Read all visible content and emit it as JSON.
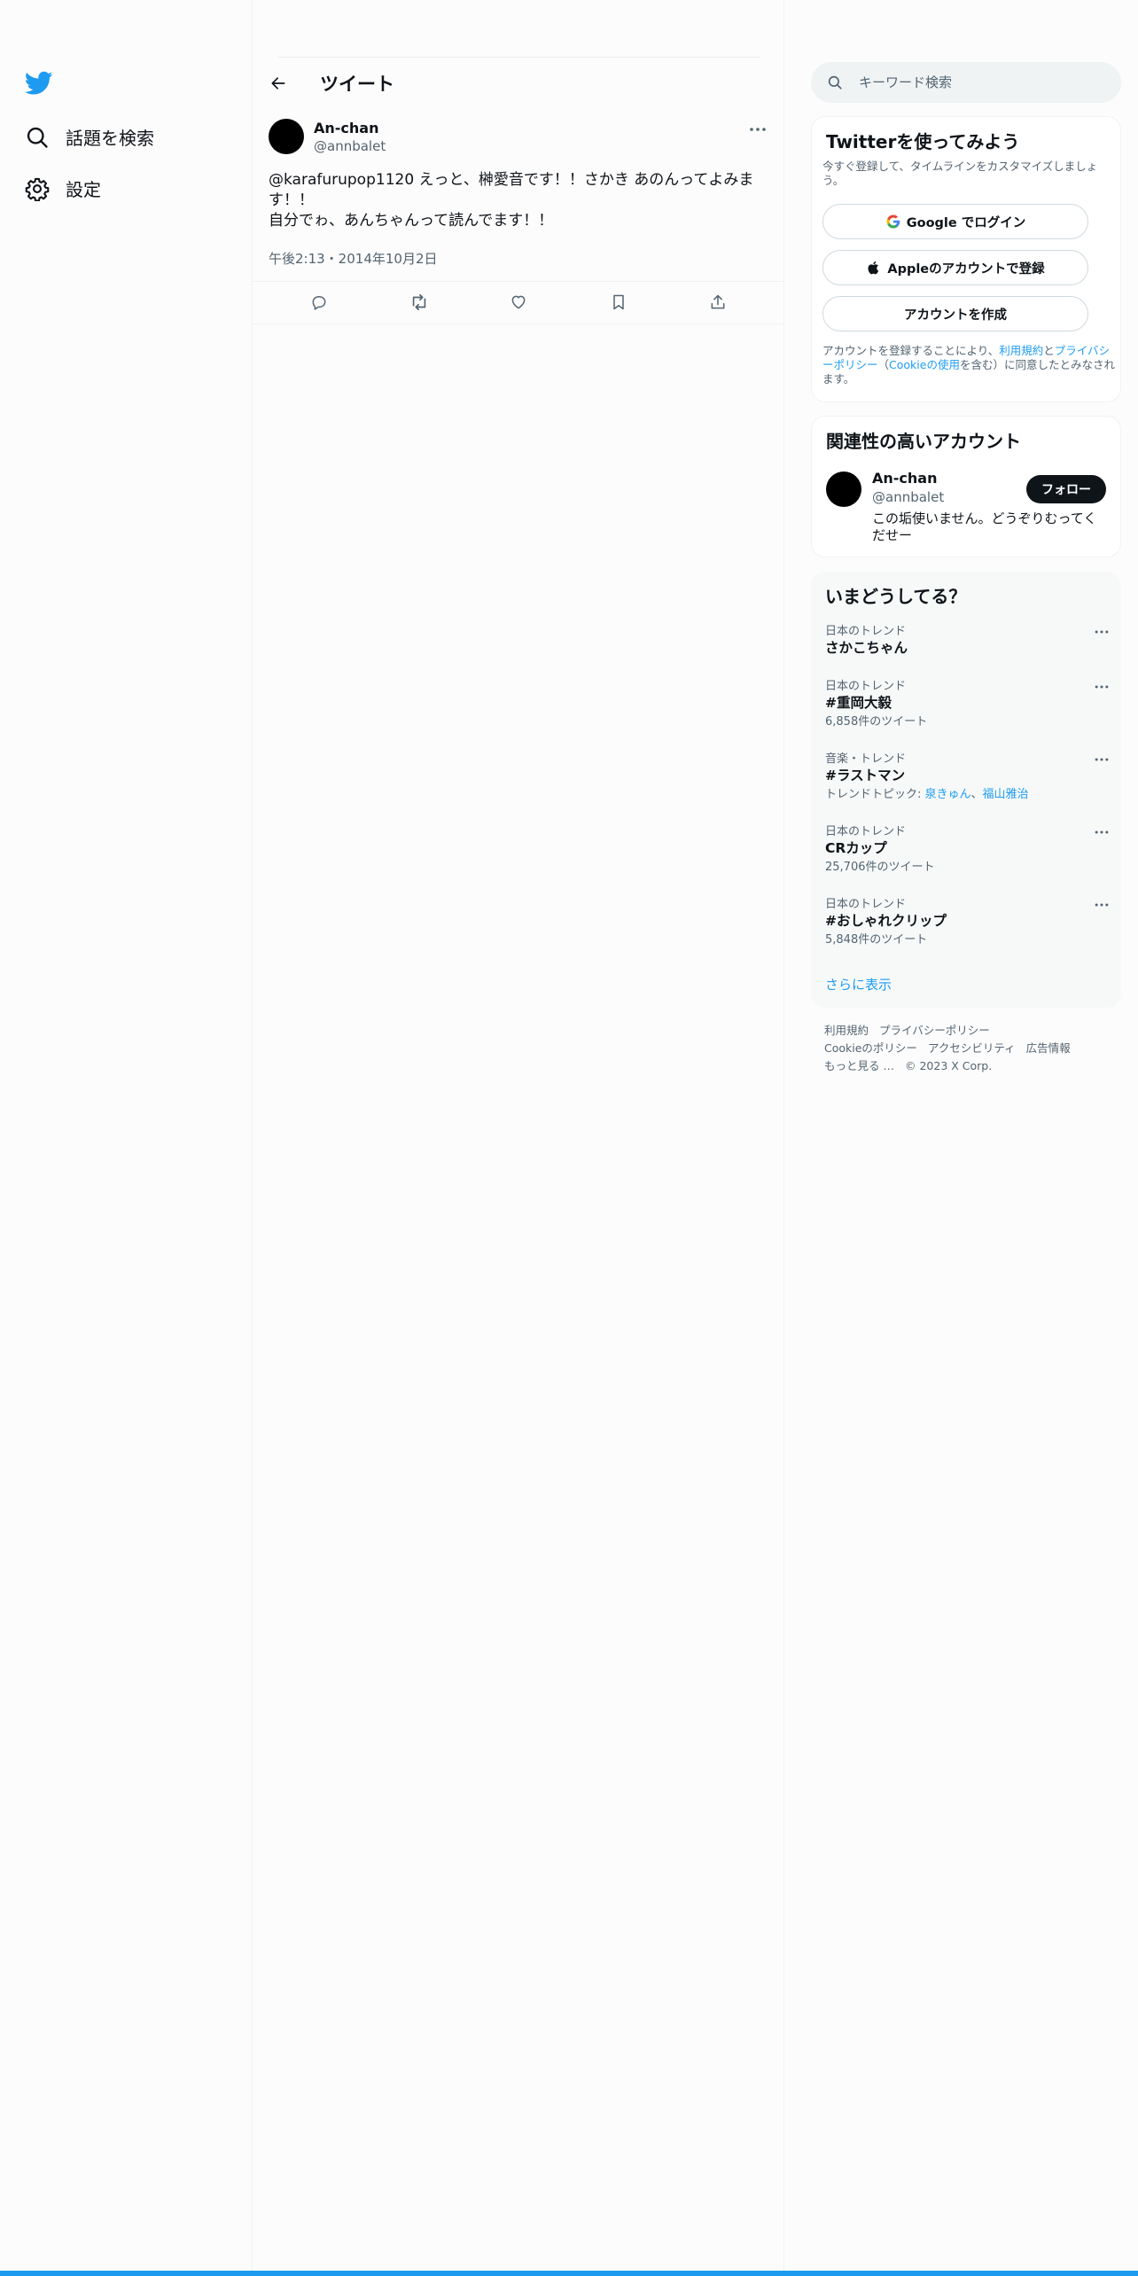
{
  "nav": {
    "items": [
      {
        "label": "話題を検索",
        "icon": "search-icon"
      },
      {
        "label": "設定",
        "icon": "gear-icon"
      }
    ]
  },
  "header": {
    "title": "ツイート"
  },
  "tweet": {
    "author_name": "An-chan",
    "author_handle": "@annbalet",
    "text_line1": "@karafurupop1120 えっと、榊愛音です！！さかき あのんってよみます！！",
    "text_line2": "自分でゎ、あんちゃんって読んでます！！",
    "timestamp": "午後2:13・2014年10月2日"
  },
  "search": {
    "placeholder": "キーワード検索"
  },
  "signup": {
    "title": "Twitterを使ってみよう",
    "subtitle": "今すぐ登録して、タイムラインをカスタマイズしましょう。",
    "google_label": "Google でログイン",
    "apple_label": "Appleのアカウントで登録",
    "create_label": "アカウントを作成",
    "legal_pre": "アカウントを登録することにより、",
    "legal_terms": "利用規約",
    "legal_and": "と",
    "legal_privacy": "プライバシーポリシー",
    "legal_paren_open": "（",
    "legal_cookie": "Cookieの使用",
    "legal_post": "を含む）に同意したとみなされます。"
  },
  "related": {
    "title": "関連性の高いアカウント",
    "name": "An-chan",
    "handle": "@annbalet",
    "bio": "この垢使いません。どうぞりむってくだせー",
    "follow_label": "フォロー"
  },
  "trends": {
    "title": "いまどうしてる？",
    "items": [
      {
        "category": "日本のトレンド",
        "name": "さかこちゃん",
        "meta": ""
      },
      {
        "category": "日本のトレンド",
        "name": "#重岡大毅",
        "meta": "6,858件のツイート"
      },
      {
        "category": "音楽・トレンド",
        "name": "#ラストマン",
        "meta_prefix": "トレンドトピック: ",
        "link1": "泉きゅん",
        "sep": "、",
        "link2": "福山雅治"
      },
      {
        "category": "日本のトレンド",
        "name": "CRカップ",
        "meta": "25,706件のツイート"
      },
      {
        "category": "日本のトレンド",
        "name": "#おしゃれクリップ",
        "meta": "5,848件のツイート"
      }
    ],
    "show_more": "さらに表示"
  },
  "footer": {
    "terms": "利用規約",
    "privacy": "プライバシーポリシー",
    "cookie": "Cookieのポリシー",
    "accessibility": "アクセシビリティ",
    "ads": "広告情報",
    "more": "もっと見る …",
    "copyright": "© 2023 X Corp."
  },
  "colors": {
    "accent": "#1d9bf0",
    "text": "#0f1419",
    "secondary": "#536471",
    "trends_bg": "#f7f9f9"
  }
}
